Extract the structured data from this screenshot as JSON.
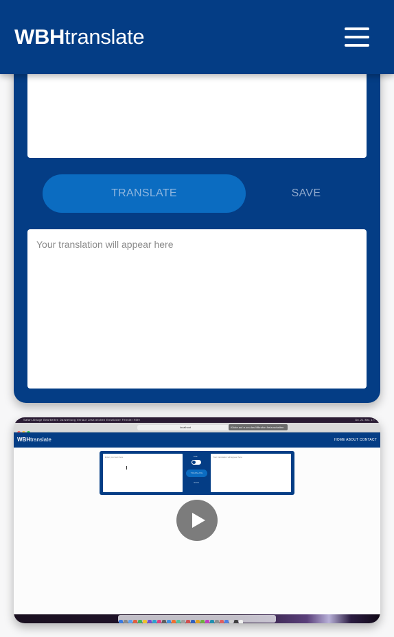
{
  "header": {
    "brand_bold": "WBH",
    "brand_light": "translate",
    "menu_icon": "hamburger-menu-icon"
  },
  "translator": {
    "input_value": "",
    "translate_label": "TRANSLATE",
    "save_label": "SAVE",
    "output_placeholder": "Your translation will appear here"
  },
  "video": {
    "play_icon": "play-icon",
    "menubar_text": "Safari   Ablage   Bearbeiten   Darstellung   Verlauf   Lesezeichen   Entwickler   Fenster   Hilfe",
    "menubar_right": "Do. 21. Mrz. 17:",
    "url": "localhost",
    "tooltip": "Klicke auf ● um das Mikrofon freizuschalten",
    "mini_brand_bold": "WBH",
    "mini_brand_light": "translate",
    "mini_nav_links": "HOME  ABOUT  CONTACT",
    "mini_input_placeholder": "Enter your text here",
    "mini_output_placeholder": "Your translation will appear here",
    "mini_toggle_label": "Live",
    "mini_translate": "TRANSLATE",
    "mini_save": "SAVE",
    "colors": {
      "traffic_red": "#ff5f57",
      "traffic_yellow": "#febc2e",
      "traffic_green": "#28c840"
    }
  },
  "colors": {
    "primary": "#043d85",
    "button": "#0b6cc1",
    "background": "#f7f7f8"
  }
}
